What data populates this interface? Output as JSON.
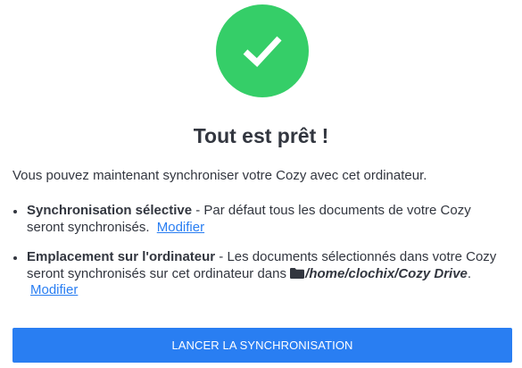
{
  "status_icon": "checkmark-icon",
  "colors": {
    "success": "#35ce68",
    "primary": "#297ef2",
    "text": "#32363f",
    "button_text": "#ffffff"
  },
  "title": "Tout est prêt !",
  "intro": "Vous pouvez maintenant synchroniser votre Cozy avec cet ordinateur.",
  "features": [
    {
      "title": "Synchronisation sélective",
      "description": " - Par défaut tous les documents de votre Cozy seront synchronisés.",
      "link": "Modifier"
    },
    {
      "title": "Emplacement sur l'ordinateur",
      "description": " - Les documents sélectionnés dans votre Cozy seront synchronisés sur cet ordinateur dans ",
      "path_icon": "folder-icon",
      "path": "/home/clochix/Cozy Drive",
      "after_path": ".",
      "link": "Modifier"
    }
  ],
  "launch_button": "LANCER LA SYNCHRONISATION"
}
